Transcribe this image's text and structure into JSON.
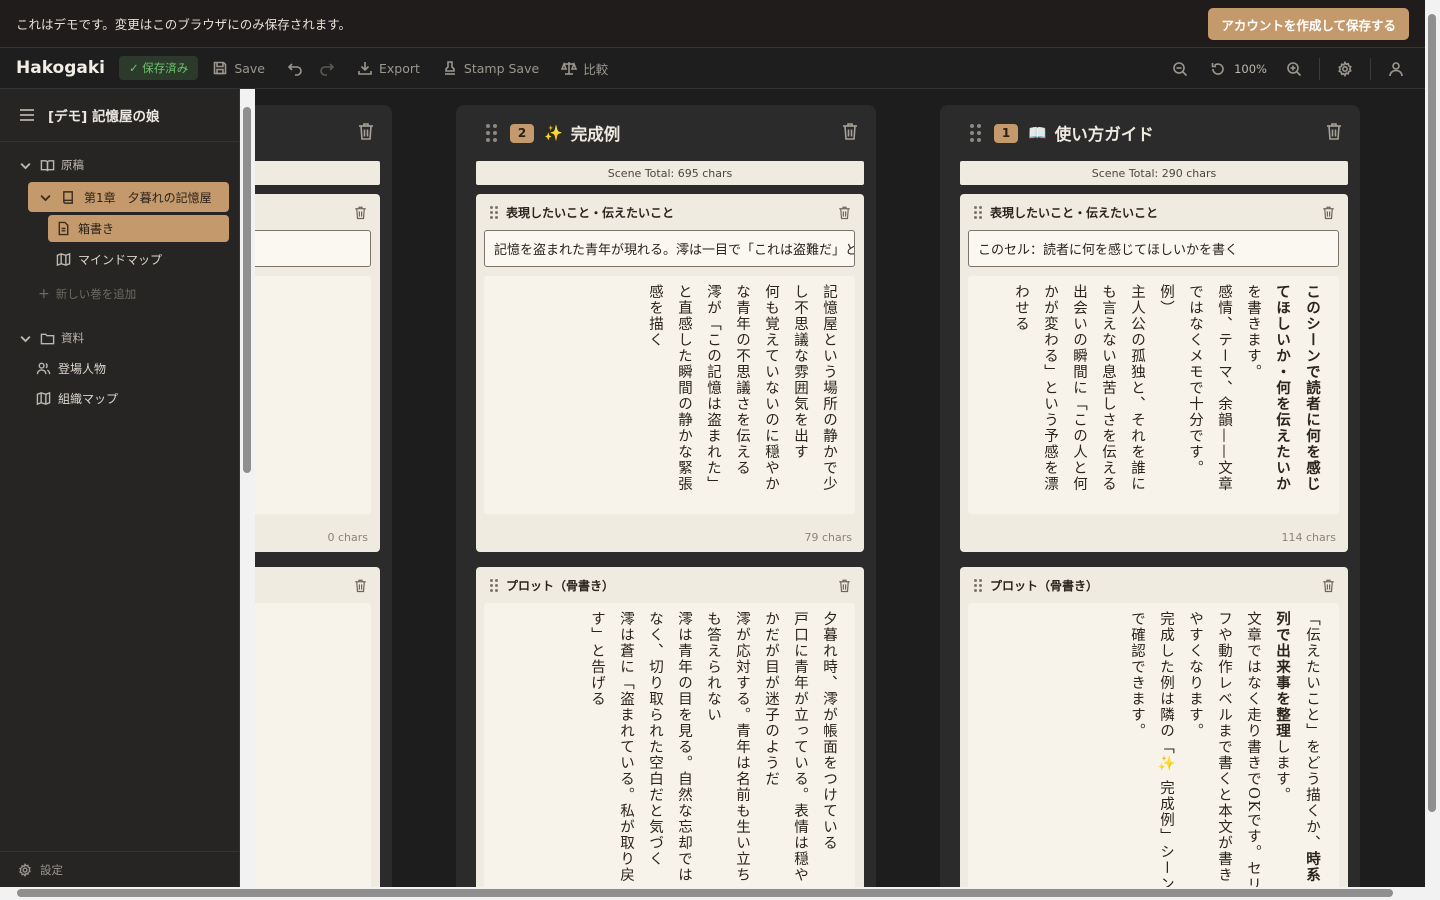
{
  "banner": {
    "text": "これはデモです。変更はこのブラウザにのみ保存されます。",
    "cta": "アカウントを作成して保存する"
  },
  "toolbar": {
    "brand": "Hakogaki",
    "saved_badge": "✓ 保存済み",
    "save": "Save",
    "export": "Export",
    "stamp_save": "Stamp Save",
    "compare": "比較",
    "zoom": "100%"
  },
  "sidebar": {
    "project_title": "[デモ] 記憶屋の娘",
    "manuscript_label": "原稿",
    "chapter_label": "第1章　夕暮れの記憶屋",
    "hakogaki_label": "箱書き",
    "mindmap_label": "マインドマップ",
    "add_book_label": "新しい巻を追加",
    "materials_label": "資料",
    "characters_label": "登場人物",
    "org_map_label": "組織マップ",
    "settings_label": "設定"
  },
  "columns": [
    {
      "id": "col-partial",
      "cells": [
        {
          "chars": "0 chars"
        }
      ]
    },
    {
      "id": "col-example",
      "badge": "2",
      "emoji": "✨",
      "title": "完成例",
      "scene_total": "Scene Total: 695 chars",
      "cells": [
        {
          "heading": "表現したいこと・伝えたいこと",
          "input": "記憶を盗まれた青年が現れる。澪は一目で「これは盗難だ」と見抜く",
          "body": "記憶屋という場所の静かで少し不思議な雰囲気を出す\n何も覚えていないのに穏やかな青年の不思議さを伝える\n澪が「この記憶は盗まれた」と直感した瞬間の静かな緊張感を描く",
          "chars": "79 chars"
        },
        {
          "heading": "プロット（骨書き）",
          "body": "夕暮れ時、澪が帳面をつけている\n戸口に青年が立っている。表情は穏やかだが目が迷子のようだ\n澪が応対する。青年は名前も生い立ちも答えられない\n澪は青年の目を見る。自然な忘却ではなく、切り取られた空白だと気づく\n澪は蒼に「盗まれている。私が取り戻す」と告げる"
        }
      ]
    },
    {
      "id": "col-guide",
      "badge": "1",
      "emoji": "📖",
      "title": "使い方ガイド",
      "scene_total": "Scene Total: 290 chars",
      "cells": [
        {
          "heading": "表現したいこと・伝えたいこと",
          "input": "このセル：読者に何を感じてほしいかを書く",
          "body_bold": "このシーンで読者に何を感じてほしいか・何を伝えたいか",
          "body": "を書きます。\n感情、テーマ、余韻——文章ではなくメモで十分です。\n例）\n主人公の孤独と、それを誰にも言えない息苦しさを伝える\n出会いの瞬間に「この人と何かが変わる」という予感を漂わせる",
          "chars": "114 chars"
        },
        {
          "heading": "プロット（骨書き）",
          "body_pre": "「伝えたいこと」をどう描くか、",
          "body_bold": "時系列で出来事を整理",
          "body": "します。\n文章ではなく走り書きでOKです。セリフや動作レベルまで書くと本文が書きやすくなります。\n完成した例は隣の「✨ 完成例」シーンで確認できます。"
        }
      ]
    }
  ]
}
